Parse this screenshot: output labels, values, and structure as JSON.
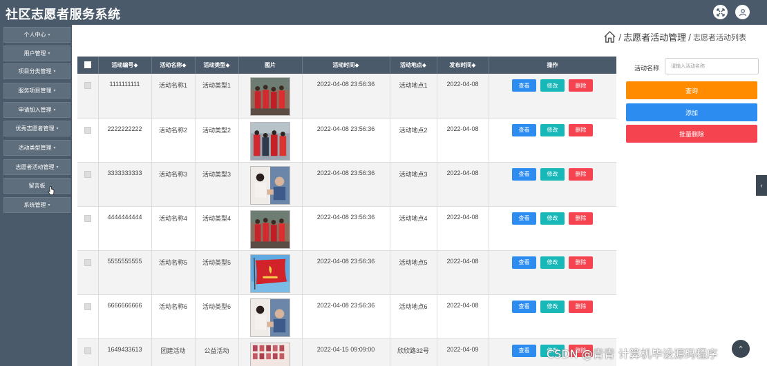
{
  "app": {
    "title": "社区志愿者服务系统"
  },
  "header": {
    "icons": [
      "fullscreen-icon",
      "user-icon"
    ]
  },
  "sidebar": {
    "items": [
      {
        "label": "个人中心"
      },
      {
        "label": "用户管理"
      },
      {
        "label": "项目分类管理"
      },
      {
        "label": "服务项目管理"
      },
      {
        "label": "申请加入管理"
      },
      {
        "label": "优秀志愿者管理"
      },
      {
        "label": "活动类型管理"
      },
      {
        "label": "志愿者活动管理"
      },
      {
        "label": "留言板"
      },
      {
        "label": "系统管理"
      }
    ]
  },
  "breadcrumb": {
    "level1": "志愿者活动管理",
    "level2": "志愿者活动列表",
    "sep": "/"
  },
  "table": {
    "headers": [
      "活动编号◆",
      "活动名称◆",
      "活动类型◆",
      "图片",
      "活动时间◆",
      "活动地点◆",
      "发布时间◆",
      "操作"
    ],
    "rows": [
      {
        "id": "1111111111",
        "name": "活动名称1",
        "type": "活动类型1",
        "time": "2022-04-08 23:56:36",
        "place": "活动地点1",
        "published": "2022-04-08"
      },
      {
        "id": "2222222222",
        "name": "活动名称2",
        "type": "活动类型2",
        "time": "2022-04-08 23:56:36",
        "place": "活动地点2",
        "published": "2022-04-08"
      },
      {
        "id": "3333333333",
        "name": "活动名称3",
        "type": "活动类型3",
        "time": "2022-04-08 23:56:36",
        "place": "活动地点3",
        "published": "2022-04-08"
      },
      {
        "id": "4444444444",
        "name": "活动名称4",
        "type": "活动类型4",
        "time": "2022-04-08 23:56:36",
        "place": "活动地点4",
        "published": "2022-04-08"
      },
      {
        "id": "5555555555",
        "name": "活动名称5",
        "type": "活动类型5",
        "time": "2022-04-08 23:56:36",
        "place": "活动地点5",
        "published": "2022-04-08"
      },
      {
        "id": "6666666666",
        "name": "活动名称6",
        "type": "活动类型6",
        "time": "2022-04-08 23:56:36",
        "place": "活动地点6",
        "published": "2022-04-08"
      },
      {
        "id": "1649433613",
        "name": "团建活动",
        "type": "公益活动",
        "time": "2022-04-15 09:09:00",
        "place": "欣欣路32号",
        "published": "2022-04-09"
      }
    ],
    "actions": {
      "view": "查看",
      "edit": "修改",
      "delete": "删除"
    }
  },
  "search": {
    "label": "活动名称",
    "placeholder": "请输入活动名称",
    "value": ""
  },
  "buttons": {
    "query": "查询",
    "add": "添加",
    "bulk_delete": "批量删除"
  },
  "watermark": "CSDN @青青  计算机毕设源码程序",
  "colors": {
    "topbar": "#4a5a6a",
    "view": "#2d8cf0",
    "edit": "#19b8b8",
    "delete": "#f5434f",
    "query": "#ff8c00"
  }
}
